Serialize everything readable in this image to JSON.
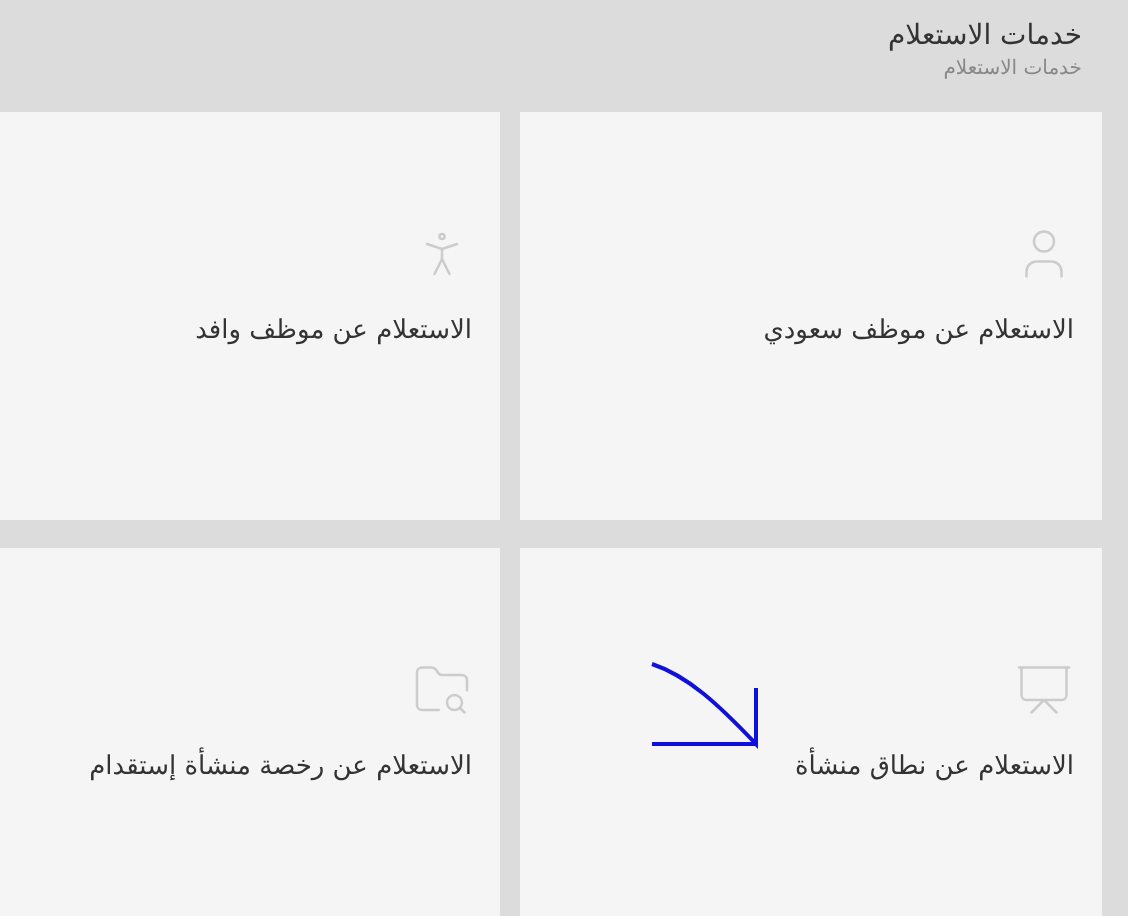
{
  "header": {
    "title": "خدمات الاستعلام",
    "breadcrumb": "خدمات الاستعلام"
  },
  "services": [
    {
      "label": "الاستعلام عن موظف سعودي",
      "kind": "user"
    },
    {
      "label": "الاستعلام عن موظف وافد",
      "kind": "person"
    },
    {
      "label": "الاستعلام عن نطاق منشأة",
      "kind": "presentation",
      "annotated": true
    },
    {
      "label": "الاستعلام عن رخصة منشأة إستقدام",
      "kind": "folder-search"
    }
  ]
}
